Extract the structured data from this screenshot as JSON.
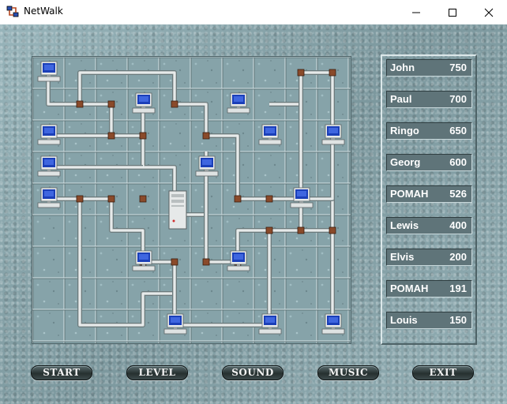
{
  "window": {
    "title": "NetWalk",
    "app_icon": "netwalk-app-icon",
    "controls": [
      "minimize-icon",
      "maximize-icon",
      "close-icon"
    ]
  },
  "board": {
    "grid": "10x9",
    "tiles": [
      "computer-icon",
      "server-icon",
      "pipe-straight",
      "pipe-corner",
      "pipe-tee"
    ]
  },
  "scores": [
    {
      "name": "John",
      "score": "750"
    },
    {
      "name": "Paul",
      "score": "700"
    },
    {
      "name": "Ringo",
      "score": "650"
    },
    {
      "name": "Georg",
      "score": "600"
    },
    {
      "name": "POMAH",
      "score": "526"
    },
    {
      "name": "Lewis",
      "score": "400"
    },
    {
      "name": "Elvis",
      "score": "200"
    },
    {
      "name": "POMAH",
      "score": "191"
    },
    {
      "name": "Louis",
      "score": "150"
    }
  ],
  "buttons": {
    "start": "START",
    "level": "LEVEL",
    "sound": "SOUND",
    "music": "MUSIC",
    "exit": "EXIT"
  }
}
